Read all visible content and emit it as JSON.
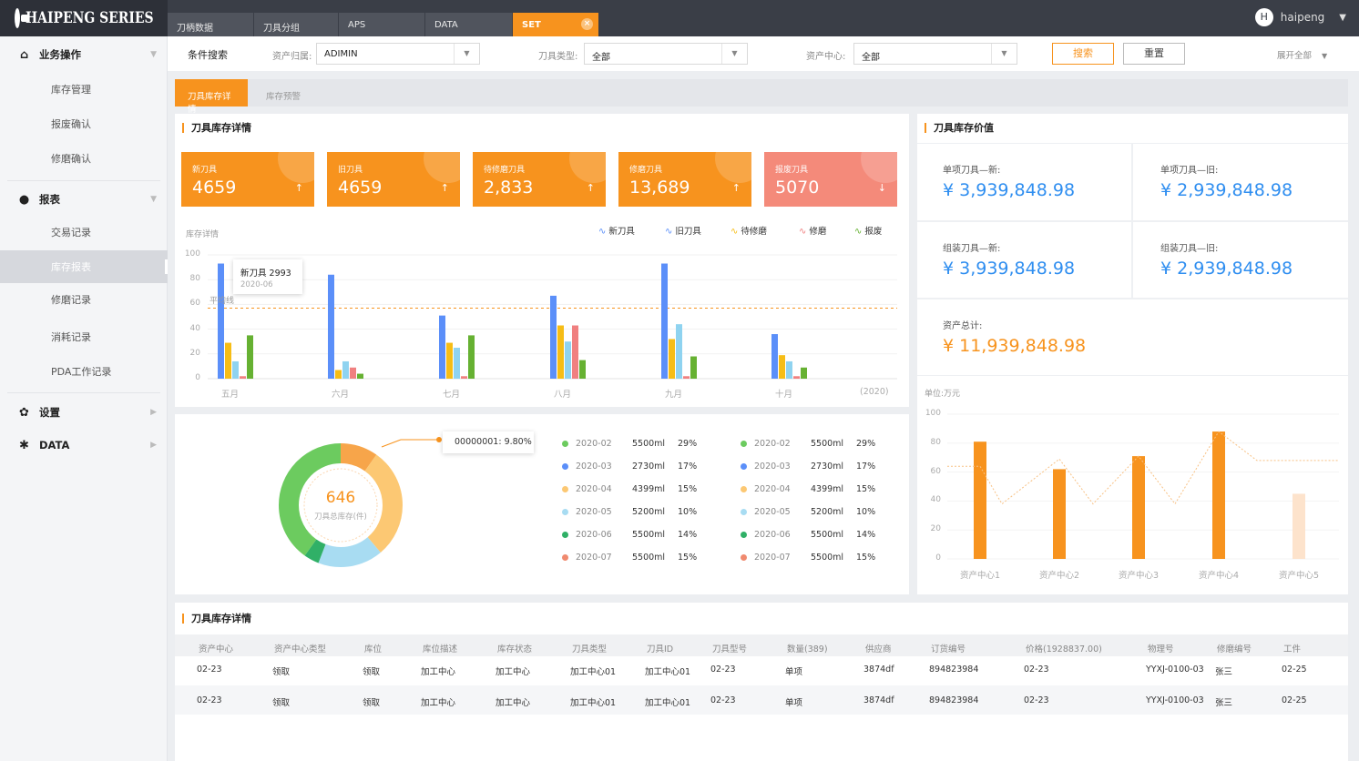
{
  "app": {
    "logo_text": "HAIPENG SERIES",
    "user_initial": "H",
    "user_name": "haipeng"
  },
  "tabs": [
    {
      "label": "刀柄数据"
    },
    {
      "label": "刀具分组"
    },
    {
      "label": "APS"
    },
    {
      "label": "DATA"
    },
    {
      "label": "SET",
      "active": true
    }
  ],
  "sidebar": {
    "groups": [
      {
        "label": "业务操作",
        "icon": "home-icon"
      },
      {
        "label": "报表",
        "icon": "report-icon"
      },
      {
        "label": "设置",
        "icon": "gear-icon"
      },
      {
        "label": "DATA",
        "icon": "data-icon"
      }
    ],
    "items_ops": [
      "库存管理",
      "报废确认",
      "修磨确认"
    ],
    "items_report": [
      "交易记录",
      "库存报表",
      "修磨记录",
      "消耗记录",
      "PDA工作记录"
    ],
    "active_item": "库存报表"
  },
  "search": {
    "title": "条件搜索",
    "owner_label": "资产归属:",
    "owner_value": "ADIMIN",
    "tooltype_label": "刀具类型:",
    "tooltype_value": "全部",
    "center_label": "资产中心:",
    "center_value": "全部",
    "search_button": "搜索",
    "reset_button": "重置",
    "expand_all": "展开全部"
  },
  "subtabs": [
    "刀具库存详情",
    "库存预警"
  ],
  "detail_panel": {
    "title": "刀具库存详情",
    "cards": [
      {
        "label": "新刀具",
        "value": "4659",
        "arrow": "↑"
      },
      {
        "label": "旧刀具",
        "value": "4659",
        "arrow": "↑"
      },
      {
        "label": "待修磨刀具",
        "value": "2,833",
        "arrow": "↑"
      },
      {
        "label": "修磨刀具",
        "value": "13,689",
        "arrow": "↑"
      },
      {
        "label": "报废刀具",
        "value": "5070",
        "arrow": "↓"
      }
    ],
    "chart_title": "库存详情",
    "avg_label": "平均线",
    "tooltip": {
      "title": "新刀具 2993",
      "date": "2020-06"
    },
    "year_label": "(2020)"
  },
  "value_panel": {
    "title": "刀具库存价值",
    "items": [
      {
        "label": "单项刀具—新:",
        "value": "¥ 3,939,848.98"
      },
      {
        "label": "单项刀具—旧:",
        "value": "¥ 2,939,848.98"
      },
      {
        "label": "组装刀具—新:",
        "value": "¥ 3,939,848.98"
      },
      {
        "label": "组装刀具—旧:",
        "value": "¥ 2,939,848.98"
      }
    ],
    "total_label": "资产总计:",
    "total_value": "¥ 11,939,848.98",
    "unit_label": "单位:万元"
  },
  "chart_data": [
    {
      "type": "bar",
      "categories": [
        "五月",
        "六月",
        "七月",
        "八月",
        "九月",
        "十月"
      ],
      "ylim": [
        0,
        100
      ],
      "yticks": [
        0,
        20,
        40,
        60,
        80,
        100
      ],
      "average": 57,
      "series": [
        {
          "name": "新刀具",
          "color": "#5b8ff9",
          "values": [
            93,
            84,
            51,
            67,
            93,
            36
          ]
        },
        {
          "name": "旧刀具",
          "color": "#f6bd16",
          "values": [
            29,
            7,
            29,
            43,
            32,
            19
          ]
        },
        {
          "name": "待修磨",
          "color": "#8fd3f0",
          "values": [
            14,
            14,
            25,
            30,
            44,
            14
          ]
        },
        {
          "name": "修磨",
          "color": "#f08080",
          "values": [
            2,
            9,
            2,
            43,
            2,
            2
          ]
        },
        {
          "name": "报废",
          "color": "#66b132",
          "values": [
            35,
            4,
            35,
            15,
            18,
            9
          ]
        }
      ]
    },
    {
      "type": "pie",
      "center_value": "646",
      "center_label": "刀具总库存(件)",
      "callout": "00000001: 9.80%",
      "slices": [
        {
          "label": "2020-02",
          "amount": "5500ml",
          "percent": 29,
          "color": "#6ccb5f"
        },
        {
          "label": "2020-03",
          "amount": "2730ml",
          "percent": 17,
          "color": "#5b8ff9"
        },
        {
          "label": "2020-04",
          "amount": "4399ml",
          "percent": 15,
          "color": "#fcc873"
        },
        {
          "label": "2020-05",
          "amount": "5200ml",
          "percent": 10,
          "color": "#a8dcf2"
        },
        {
          "label": "2020-06",
          "amount": "5500ml",
          "percent": 14,
          "color": "#30b067"
        },
        {
          "label": "2020-07",
          "amount": "5500ml",
          "percent": 15,
          "color": "#f08a6f"
        }
      ],
      "ring": [
        {
          "percent": 9.8,
          "color": "#f7a54a"
        },
        {
          "percent": 29,
          "color": "#fcc873"
        },
        {
          "percent": 17,
          "color": "#a8dcf2"
        },
        {
          "percent": 4,
          "color": "#30b067"
        },
        {
          "percent": 40.2,
          "color": "#6ccb5f"
        }
      ]
    },
    {
      "type": "bar",
      "categories": [
        "资产中心1",
        "资产中心2",
        "资产中心3",
        "资产中心4",
        "资产中心5"
      ],
      "ylim": [
        0,
        100
      ],
      "yticks": [
        0,
        20,
        40,
        60,
        80,
        100
      ],
      "values": [
        81,
        62,
        71,
        88,
        45
      ],
      "colors": [
        "#f7931e",
        "#f7931e",
        "#f7931e",
        "#f7931e",
        "#fde3cc"
      ],
      "line": [
        64,
        64,
        38,
        69,
        38,
        71,
        38,
        88,
        68,
        68
      ]
    }
  ],
  "table": {
    "title": "刀具库存详情",
    "headers": [
      "资产中心",
      "资产中心类型",
      "库位",
      "库位描述",
      "库存状态",
      "刀具类型",
      "刀具ID",
      "刀具型号",
      "数量(389)",
      "供应商",
      "订货编号",
      "价格(1928837.00)",
      "物理号",
      "修磨编号",
      "工件"
    ],
    "rows": [
      [
        "02-23",
        "领取",
        "领取",
        "加工中心",
        "加工中心",
        "加工中心01",
        "加工中心01",
        "02-23",
        "单项",
        "3874df",
        "894823984",
        "02-23",
        "YYXJ-0100-03",
        "张三",
        "02-25"
      ],
      [
        "02-23",
        "领取",
        "领取",
        "加工中心",
        "加工中心",
        "加工中心01",
        "加工中心01",
        "02-23",
        "单项",
        "3874df",
        "894823984",
        "02-23",
        "YYXJ-0100-03",
        "张三",
        "02-25"
      ]
    ]
  }
}
